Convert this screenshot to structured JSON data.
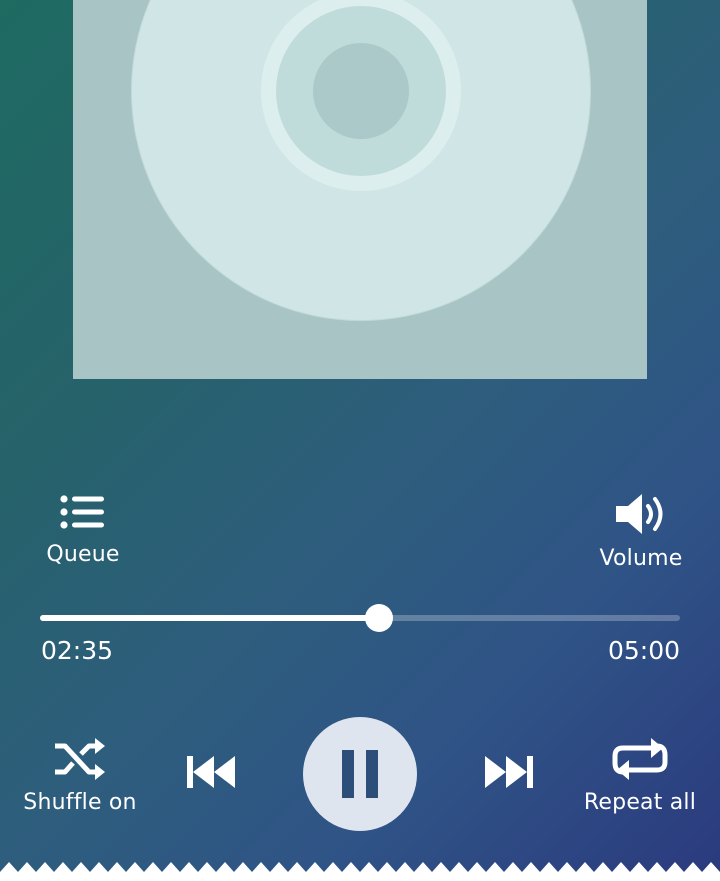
{
  "album_art": {
    "background_color": "#a9c4c4",
    "disc_color": "#d0e6e6"
  },
  "controls": {
    "queue_label": "Queue",
    "volume_label": "Volume",
    "shuffle_label": "Shuffle on",
    "repeat_label": "Repeat all"
  },
  "playback": {
    "current_time": "02:35",
    "total_time": "05:00",
    "progress_fraction": 0.53,
    "state": "playing"
  },
  "icons": {
    "queue": "queue-list-icon",
    "volume": "volume-icon",
    "shuffle": "shuffle-icon",
    "previous": "skip-previous-icon",
    "pause": "pause-icon",
    "next": "skip-next-icon",
    "repeat": "repeat-icon"
  },
  "colors": {
    "gradient_start": "#1e6b62",
    "gradient_end": "#2b3a7e",
    "play_button_bg": "#dfe5ee",
    "play_button_icon": "#2c4f7a"
  }
}
